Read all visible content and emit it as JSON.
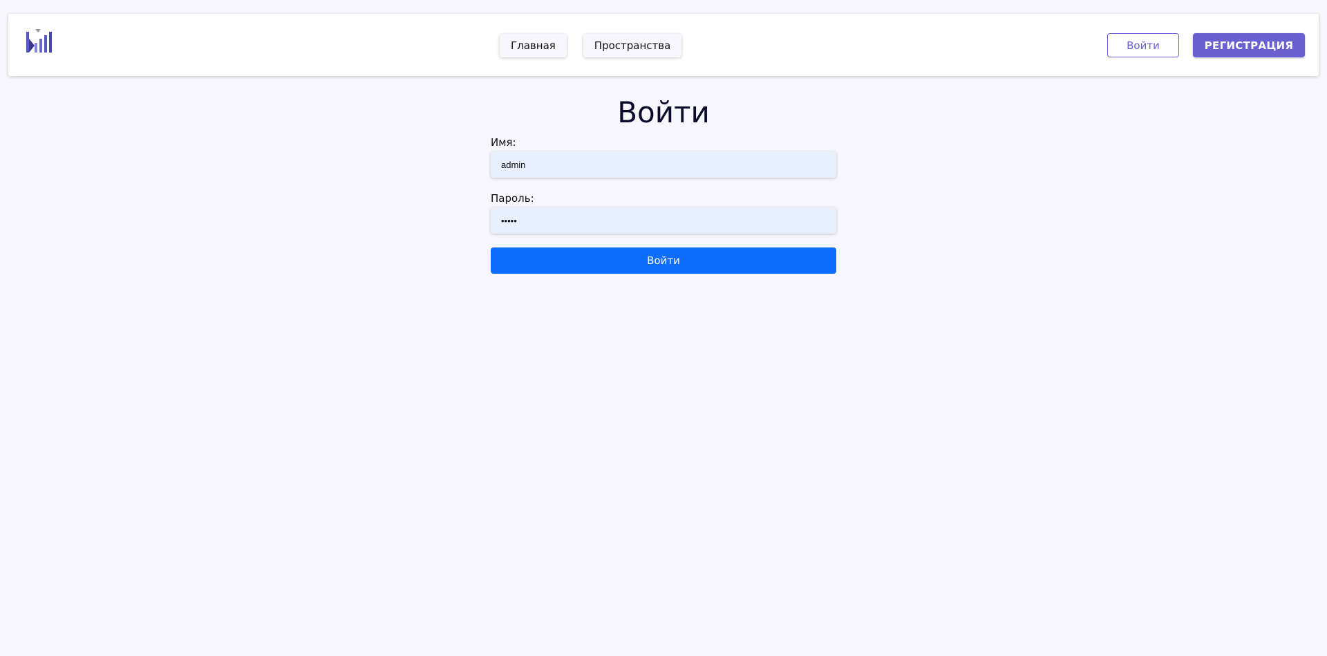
{
  "colors": {
    "page_background": "#f7f7fd",
    "brand": "#6a5fd0",
    "primary_button": "#0d6efd",
    "input_background": "#e8f0fe"
  },
  "header": {
    "logo_icon": "bar-chart-logo-icon",
    "nav": {
      "home_label": "Главная",
      "spaces_label": "Пространства"
    },
    "login_label": "Войти",
    "register_label": "РЕГИСТРАЦИЯ"
  },
  "login_form": {
    "title": "Войти",
    "username_label": "Имя:",
    "username_value": "admin",
    "password_label": "Пароль:",
    "password_value": "admin",
    "submit_label": "Войти"
  }
}
